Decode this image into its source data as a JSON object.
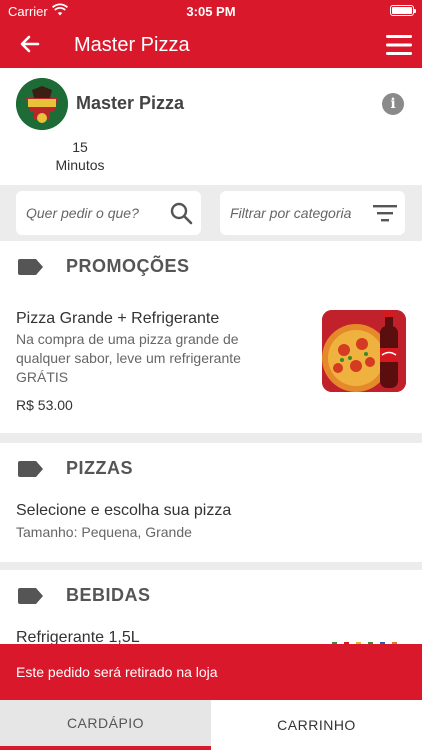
{
  "status_bar": {
    "carrier": "Carrier",
    "time": "3:05 PM"
  },
  "nav": {
    "title": "Master Pizza"
  },
  "restaurant": {
    "name": "Master Pizza",
    "delivery_time_value": "15",
    "delivery_time_unit": "Minutos"
  },
  "filters": {
    "search_placeholder": "Quer pedir o que?",
    "category_placeholder": "Filtrar por categoria"
  },
  "sections": [
    {
      "label": "PROMOÇÕES"
    },
    {
      "label": "PIZZAS"
    },
    {
      "label": "BEBIDAS"
    }
  ],
  "items": {
    "promo": {
      "name": "Pizza Grande + Refrigerante",
      "desc_lines": [
        "Na compra de uma pizza grande de",
        "qualquer sabor, leve um refrigerante",
        "GRÁTIS"
      ],
      "price": "R$ 53.00"
    },
    "pizza": {
      "name": "Selecione e escolha sua pizza",
      "desc": "Tamanho: Pequena, Grande"
    },
    "drink": {
      "name": "Refrigerante 1,5L"
    }
  },
  "notice": "Este pedido será retirado na loja",
  "tabs": {
    "menu": "CARDÁPIO",
    "cart": "CARRINHO"
  },
  "colors": {
    "primary": "#d9192b",
    "background": "#ececec"
  },
  "icons": [
    "back-arrow-icon",
    "hamburger-menu-icon",
    "info-icon",
    "search-icon",
    "filter-icon",
    "tag-icon",
    "wifi-icon",
    "battery-icon"
  ]
}
